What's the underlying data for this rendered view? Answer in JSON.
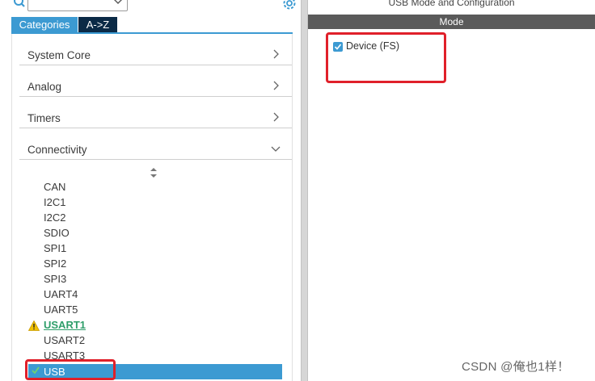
{
  "config_title": "USB Mode and Configuration",
  "mode_header": "Mode",
  "device_option": {
    "label": "Device (FS)",
    "checked": true
  },
  "tabs": [
    {
      "label": "Categories",
      "active": true
    },
    {
      "label": "A->Z",
      "active": false
    }
  ],
  "categories": [
    {
      "label": "System Core",
      "expanded": false
    },
    {
      "label": "Analog",
      "expanded": false
    },
    {
      "label": "Timers",
      "expanded": false
    },
    {
      "label": "Connectivity",
      "expanded": true
    }
  ],
  "peripherals": [
    "CAN",
    "I2C1",
    "I2C2",
    "SDIO",
    "SPI1",
    "SPI2",
    "SPI3",
    "UART4",
    "UART5",
    "USART1",
    "USART2",
    "USART3",
    "USB"
  ],
  "warning_peripheral": "USART1",
  "selected_peripheral": "USB",
  "watermark": "CSDN @俺也1样！",
  "colors": {
    "accent": "#3c9ad2",
    "tab_dark": "#0b2a46",
    "highlight": "#e0202a",
    "warning": "#f2c200",
    "mode_bar": "#5a5a5a"
  }
}
